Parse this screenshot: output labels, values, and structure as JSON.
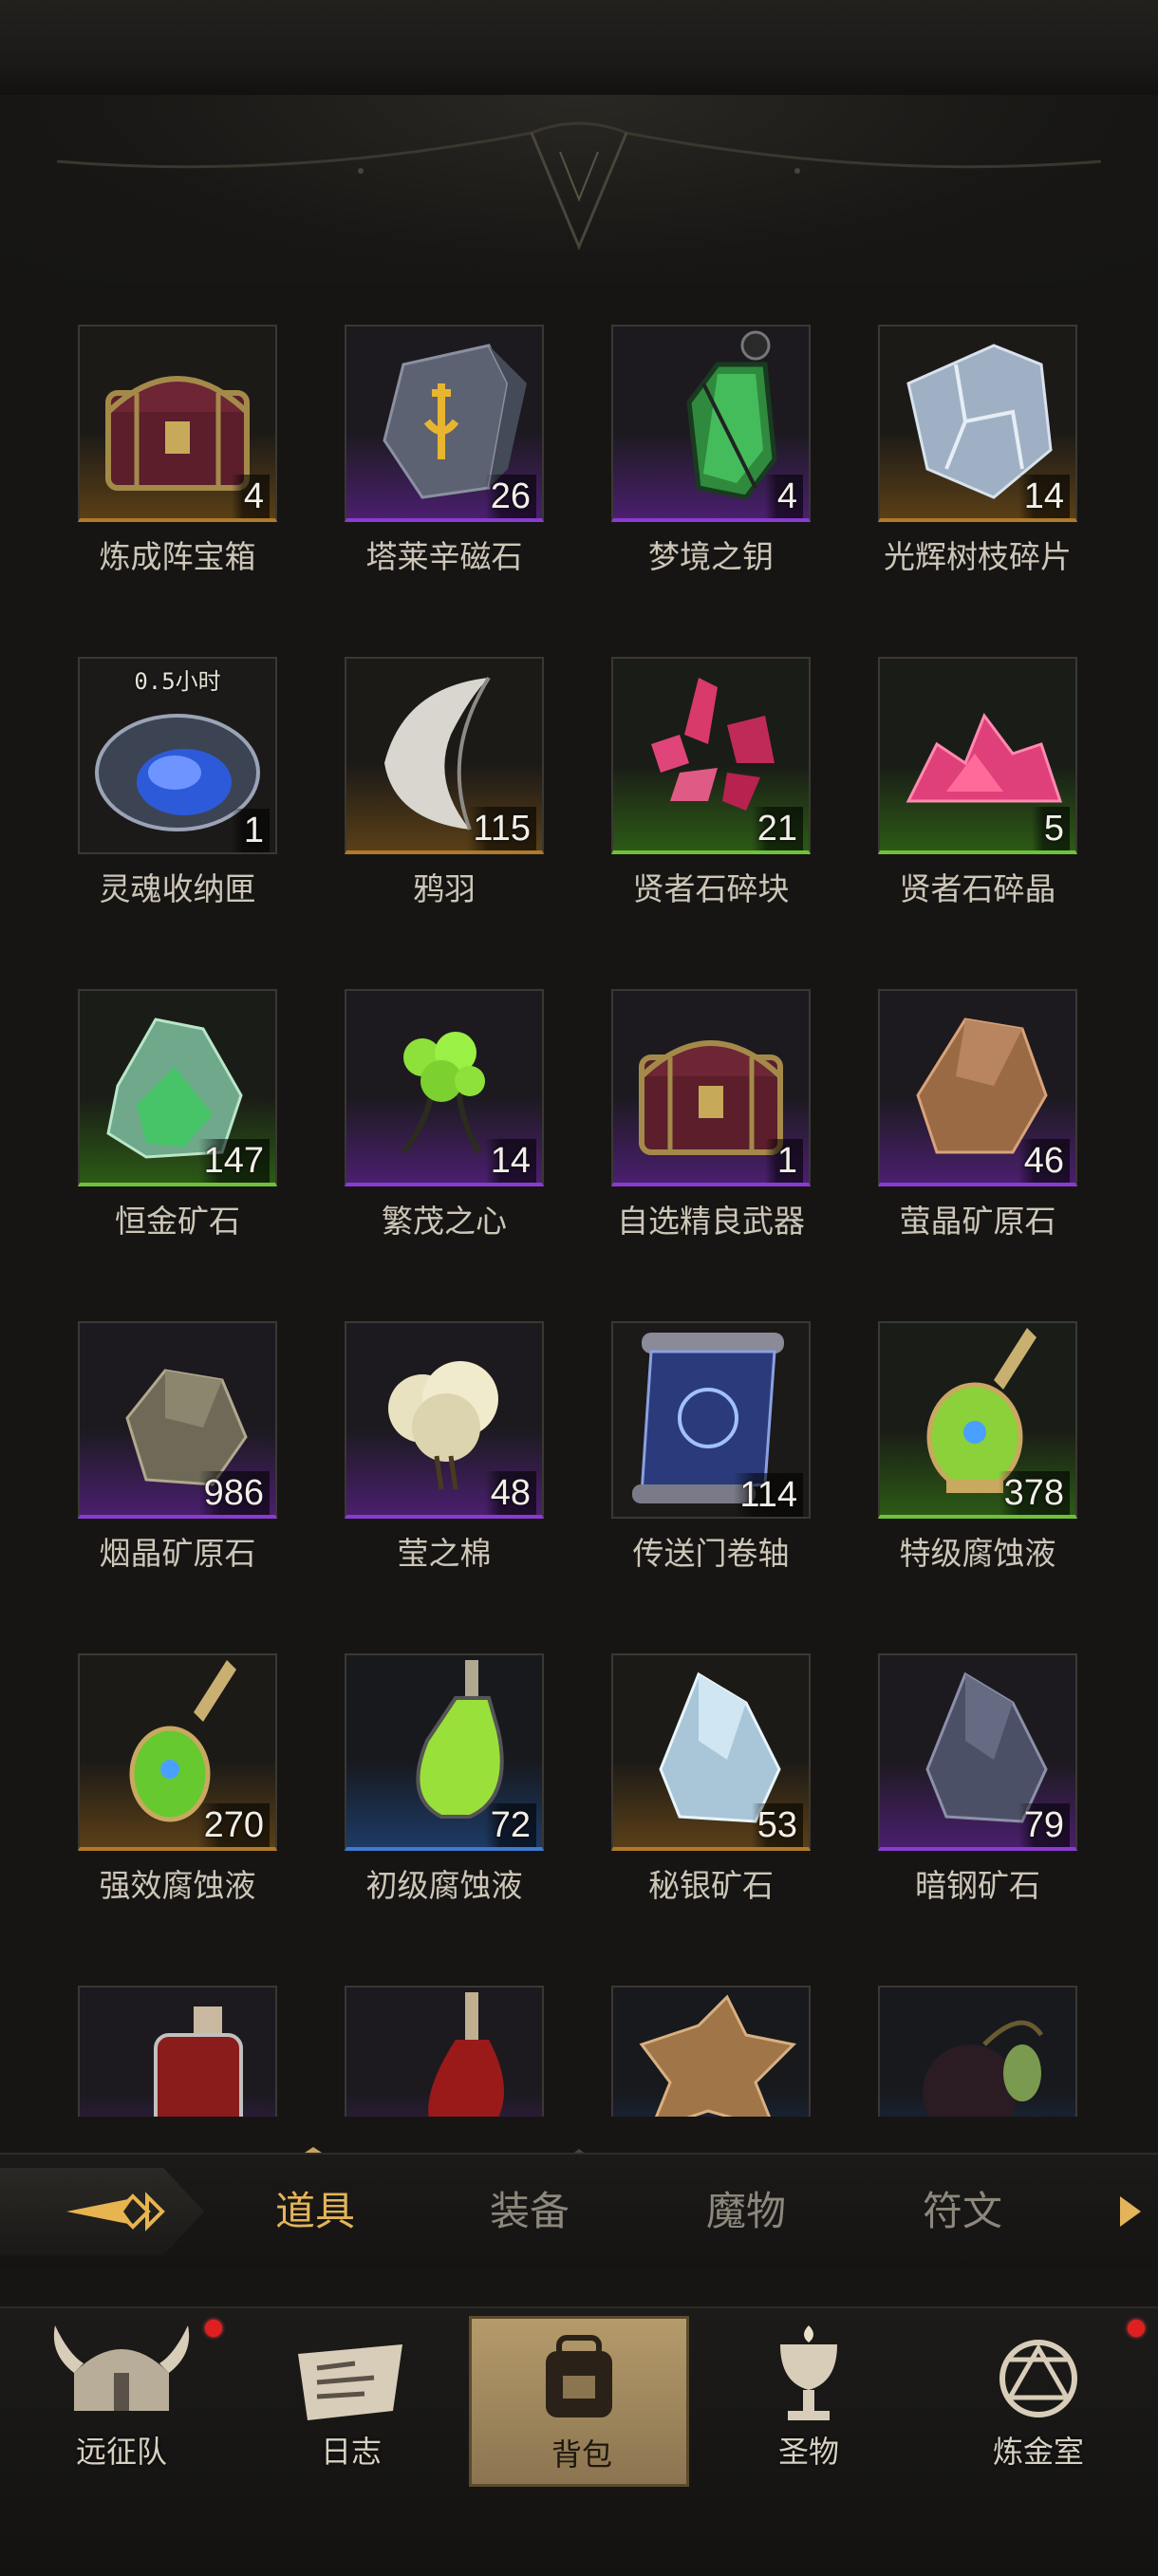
{
  "items": [
    {
      "name": "炼成阵宝箱",
      "count": "4",
      "rarity": "gold",
      "icon": "treasure-chest-icon"
    },
    {
      "name": "塔莱辛磁石",
      "count": "26",
      "rarity": "purple",
      "icon": "rune-stone-icon"
    },
    {
      "name": "梦境之钥",
      "count": "4",
      "rarity": "purple",
      "icon": "green-lantern-icon"
    },
    {
      "name": "光辉树枝碎片",
      "count": "14",
      "rarity": "gold",
      "icon": "crystal-shard-icon"
    },
    {
      "name": "灵魂收纳匣",
      "count": "1",
      "rarity": "none",
      "icon": "soul-box-icon",
      "timer": "0.5小时"
    },
    {
      "name": "鸦羽",
      "count": "115",
      "rarity": "gold",
      "icon": "feather-icon"
    },
    {
      "name": "贤者石碎块",
      "count": "21",
      "rarity": "green",
      "icon": "red-crystal-icon"
    },
    {
      "name": "贤者石碎晶",
      "count": "5",
      "rarity": "green",
      "icon": "pink-crystal-icon"
    },
    {
      "name": "恒金矿石",
      "count": "147",
      "rarity": "green",
      "icon": "green-ore-icon"
    },
    {
      "name": "繁茂之心",
      "count": "14",
      "rarity": "purple",
      "icon": "green-heart-icon"
    },
    {
      "name": "自选精良武器",
      "count": "1",
      "rarity": "purple",
      "icon": "treasure-chest-icon"
    },
    {
      "name": "萤晶矿原石",
      "count": "46",
      "rarity": "purple",
      "icon": "amber-ore-icon"
    },
    {
      "name": "烟晶矿原石",
      "count": "986",
      "rarity": "purple",
      "icon": "smoky-ore-icon"
    },
    {
      "name": "莹之棉",
      "count": "48",
      "rarity": "purple",
      "icon": "cotton-icon"
    },
    {
      "name": "传送门卷轴",
      "count": "114",
      "rarity": "none",
      "icon": "scroll-icon"
    },
    {
      "name": "特级腐蚀液",
      "count": "378",
      "rarity": "green",
      "icon": "green-potion-icon"
    },
    {
      "name": "强效腐蚀液",
      "count": "270",
      "rarity": "gold",
      "icon": "green-potion-icon"
    },
    {
      "name": "初级腐蚀液",
      "count": "72",
      "rarity": "blue",
      "icon": "green-flask-icon"
    },
    {
      "name": "秘银矿石",
      "count": "53",
      "rarity": "gold",
      "icon": "mithril-ore-icon"
    },
    {
      "name": "暗钢矿石",
      "count": "79",
      "rarity": "purple",
      "icon": "dark-ore-icon"
    },
    {
      "name": "",
      "count": "",
      "rarity": "purple",
      "icon": "red-potion-icon"
    },
    {
      "name": "",
      "count": "",
      "rarity": "purple",
      "icon": "red-flask-icon"
    },
    {
      "name": "",
      "count": "",
      "rarity": "blue",
      "icon": "leather-hide-icon"
    },
    {
      "name": "",
      "count": "",
      "rarity": "blue",
      "icon": "dark-fruit-icon"
    }
  ],
  "tabs": [
    "道具",
    "装备",
    "魔物",
    "符文"
  ],
  "active_tab": "道具",
  "nav": [
    {
      "label": "远征队",
      "icon": "viking-helmet-icon",
      "badge": true
    },
    {
      "label": "日志",
      "icon": "map-scroll-icon",
      "badge": false
    },
    {
      "label": "背包",
      "icon": "backpack-icon",
      "badge": false,
      "active": true
    },
    {
      "label": "圣物",
      "icon": "chalice-icon",
      "badge": false
    },
    {
      "label": "炼金室",
      "icon": "alchemy-icon",
      "badge": true
    }
  ],
  "colors": {
    "gold": "#b07a2a",
    "purple": "#8a3bd0",
    "green": "#6ec23b",
    "blue": "#3e7ad0",
    "accent": "#e4b45a"
  }
}
